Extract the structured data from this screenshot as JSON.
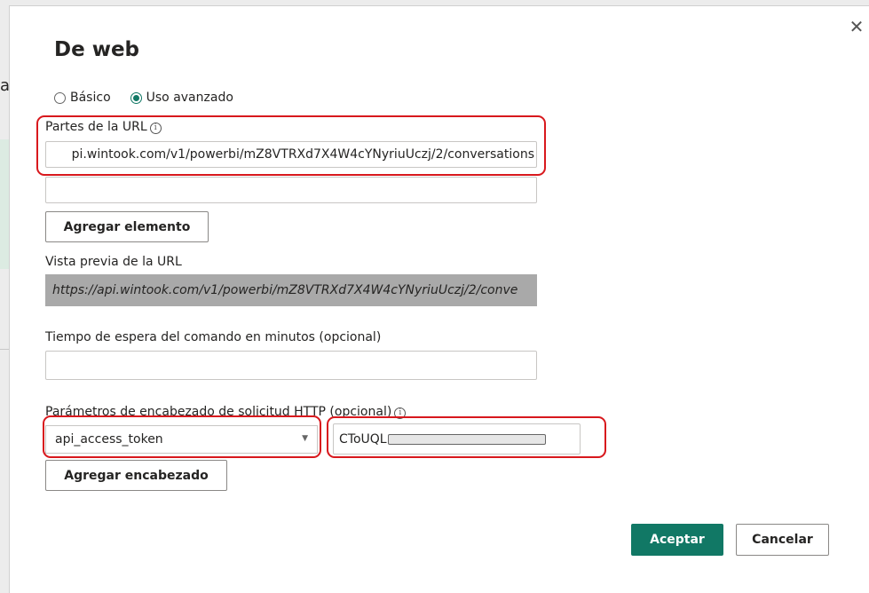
{
  "background": {
    "fragment_letter": "a"
  },
  "dialog": {
    "title": "De web",
    "close_glyph": "✕",
    "mode": {
      "options": [
        {
          "label": "Básico",
          "selected": false
        },
        {
          "label": "Uso avanzado",
          "selected": true
        }
      ]
    },
    "url_parts": {
      "label": "Partes de la URL",
      "info_glyph": "i",
      "values": [
        "pi.wintook.com/v1/powerbi/mZ8VTRXd7X4W4cYNyriuUczj/2/conversations",
        ""
      ],
      "add_button_label": "Agregar elemento"
    },
    "url_preview": {
      "label": "Vista previa de la URL",
      "value": "https://api.wintook.com/v1/powerbi/mZ8VTRXd7X4W4cYNyriuUczj/2/conve"
    },
    "timeout": {
      "label": "Tiempo de espera del comando en minutos (opcional)",
      "value": ""
    },
    "headers": {
      "label": "Parámetros de encabezado de solicitud HTTP (opcional)",
      "info_glyph": "i",
      "name_selected": "api_access_token",
      "value_prefix": "CToUQL",
      "add_button_label": "Agregar encabezado"
    },
    "footer": {
      "accept_label": "Aceptar",
      "cancel_label": "Cancelar"
    }
  },
  "colors": {
    "primary": "#117865",
    "highlight": "#d8181d"
  }
}
